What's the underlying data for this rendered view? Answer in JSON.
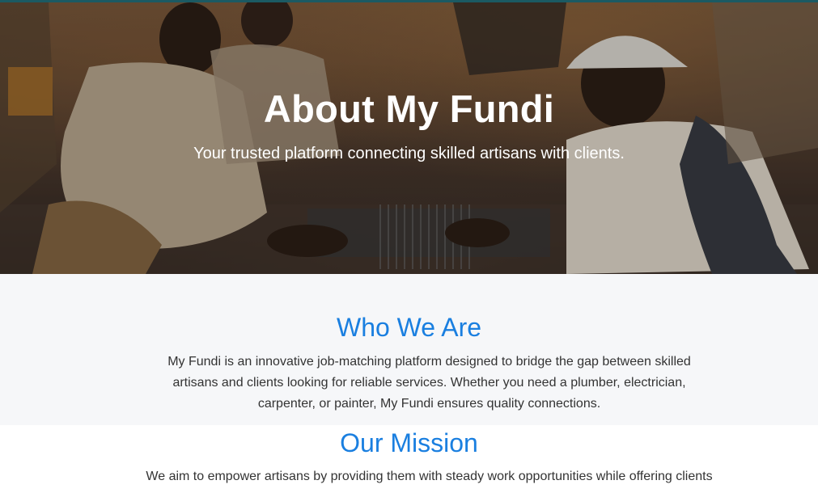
{
  "hero": {
    "title": "About My Fundi",
    "subtitle": "Your trusted platform connecting skilled artisans with clients."
  },
  "who_we_are": {
    "title": "Who We Are",
    "text": "My Fundi is an innovative job-matching platform designed to bridge the gap between skilled artisans and clients looking for reliable services. Whether you need a plumber, electrician, carpenter, or painter, My Fundi ensures quality connections."
  },
  "mission": {
    "title": "Our Mission",
    "text": "We aim to empower artisans by providing them with steady work opportunities while offering clients"
  }
}
